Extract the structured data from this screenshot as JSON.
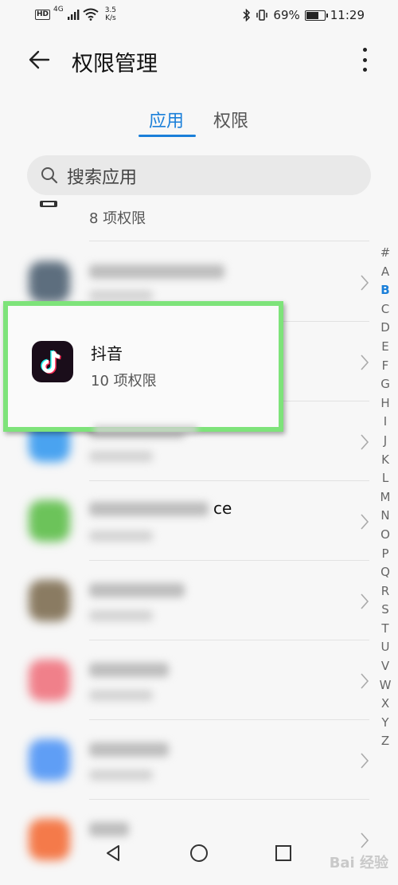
{
  "status_bar": {
    "hd": "HD",
    "network": "4G",
    "speed_value": "3.5",
    "speed_unit": "K/s",
    "battery": "69%",
    "battery_level": 0.69,
    "time": "11:29"
  },
  "header": {
    "title": "权限管理"
  },
  "tabs": [
    {
      "label": "应用",
      "active": true
    },
    {
      "label": "权限",
      "active": false
    }
  ],
  "search": {
    "placeholder": "搜索应用"
  },
  "list": {
    "partial_item_sub": "8 项权限",
    "highlighted_item": {
      "name": "抖音",
      "sub": "10 项权限"
    },
    "blurred_fragment": "ce"
  },
  "alphabet_index": [
    "#",
    "A",
    "B",
    "C",
    "D",
    "E",
    "F",
    "G",
    "H",
    "I",
    "J",
    "K",
    "L",
    "M",
    "N",
    "O",
    "P",
    "Q",
    "R",
    "S",
    "T",
    "U",
    "V",
    "W",
    "X",
    "Y",
    "Z"
  ],
  "alphabet_active": "B",
  "watermark": "Bai 经验",
  "colors": {
    "accent": "#1a7fd9",
    "highlight_border": "#7ee37a"
  }
}
